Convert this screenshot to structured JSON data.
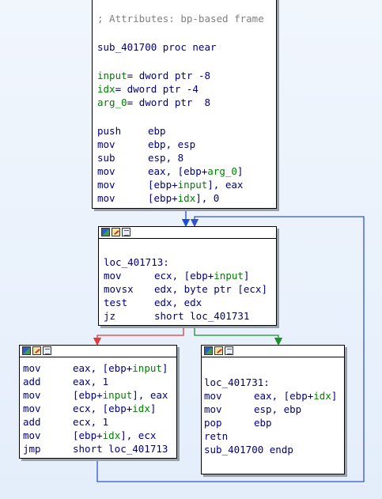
{
  "colors": {
    "text": "#000080",
    "comment": "#808080",
    "operand_ref": "#008000",
    "edge_false": "#e03a3a",
    "edge_true": "#1a8f2a",
    "edge_loop": "#3355cc",
    "edge_default": "#1b4fd1"
  },
  "block1": {
    "comment": "; Attributes: bp-based frame",
    "proc": "sub_401700 proc near",
    "vars": [
      {
        "name": "input",
        "rest": "= dword ptr -8"
      },
      {
        "name": "idx",
        "rest": "= dword ptr -4"
      },
      {
        "name": "arg_0",
        "rest": "= dword ptr  8"
      }
    ],
    "instructions": [
      {
        "mnem": "push",
        "ops": "ebp"
      },
      {
        "mnem": "mov",
        "ops": "ebp, esp"
      },
      {
        "mnem": "sub",
        "ops": "esp, 8"
      },
      {
        "mnem": "mov",
        "ops": "eax, [ebp+arg_0]"
      },
      {
        "mnem": "mov",
        "ops": "[ebp+input], eax"
      },
      {
        "mnem": "mov",
        "ops": "[ebp+idx], 0"
      }
    ]
  },
  "block2": {
    "label": "loc_401713:",
    "instructions": [
      {
        "mnem": "mov",
        "ops": "ecx, [ebp+input]"
      },
      {
        "mnem": "movsx",
        "ops": "edx, byte ptr [ecx]"
      },
      {
        "mnem": "test",
        "ops": "edx, edx"
      },
      {
        "mnem": "jz",
        "ops": "short loc_401731"
      }
    ]
  },
  "block3": {
    "instructions": [
      {
        "mnem": "mov",
        "ops": "eax, [ebp+input]"
      },
      {
        "mnem": "add",
        "ops": "eax, 1"
      },
      {
        "mnem": "mov",
        "ops": "[ebp+input], eax"
      },
      {
        "mnem": "mov",
        "ops": "ecx, [ebp+idx]"
      },
      {
        "mnem": "add",
        "ops": "ecx, 1"
      },
      {
        "mnem": "mov",
        "ops": "[ebp+idx], ecx"
      },
      {
        "mnem": "jmp",
        "ops": "short loc_401713"
      }
    ]
  },
  "block4": {
    "label": "loc_401731:",
    "instructions": [
      {
        "mnem": "mov",
        "ops": "eax, [ebp+idx]"
      },
      {
        "mnem": "mov",
        "ops": "esp, ebp"
      },
      {
        "mnem": "pop",
        "ops": "ebp"
      },
      {
        "mnem": "retn",
        "ops": ""
      }
    ],
    "endp": "sub_401700 endp"
  }
}
